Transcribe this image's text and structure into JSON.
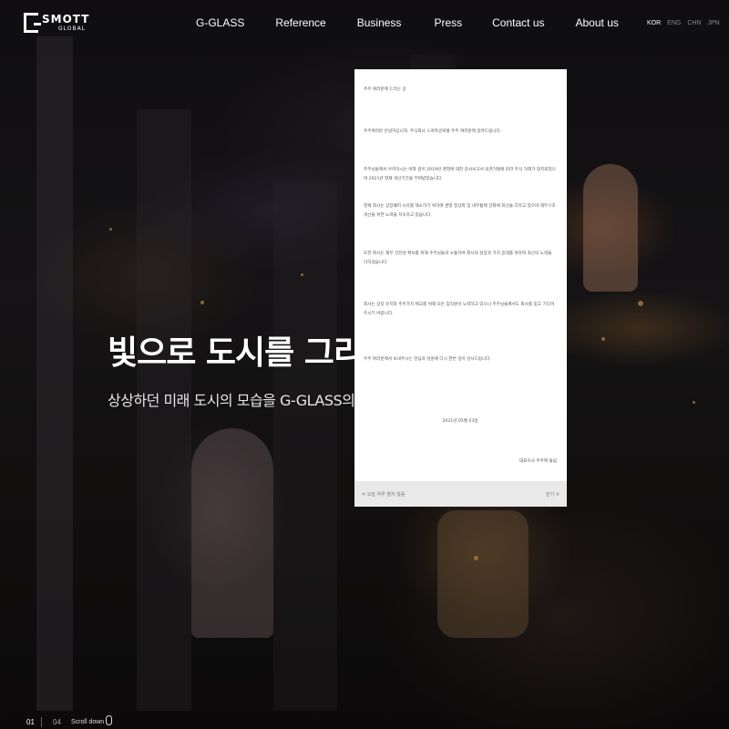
{
  "header": {
    "logo": {
      "word": "SMOTT",
      "sub": "GLOBAL"
    },
    "nav": [
      "G-GLASS",
      "Reference",
      "Business",
      "Press",
      "Contact us",
      "About us"
    ],
    "languages": [
      "KOR",
      "ENG",
      "CHN",
      "JPN"
    ],
    "active_language": "KOR"
  },
  "hero": {
    "title": "빛으로 도시를 그리다",
    "subtitle": "상상하던 미래 도시의 모습을 G-GLASS의 기술로 현실화 합니다"
  },
  "popup": {
    "greeting": "주주 여러분께 드리는 글",
    "paragraphs": [
      "주주여러분 안녕하십니까, 주식회사 스마트글로벌 주주 여러분께 알려드립니다.",
      "주주님들께서 우려하시는 바와 같이 2019년 경영에 대한 감사보고서 의견거절에 따라 주식 거래가 정지되었으며 2021년 현재 개선기간을 부여받았습니다.",
      "현재 회사는 상장폐지 사유를 해소하기 위하여 경영 정상화 및 내부통제 강화에 최선을 다하고 있으며 재무구조 개선을 위한 노력을 지속하고 있습니다.",
      "또한 회사는 재무 건전성 확보를 위해 주주님들과 소통하며 회사의 성장과 가치 증대를 위하여 최선의 노력을 다하겠습니다.",
      "회사는 상장 유지와 주주가치 제고를 위해 모든 임직원이 노력하고 있으니 주주님들께서도 회사를 믿고 기다려 주시기 바랍니다.",
      "주주 여러분께서 보내주시는 관심과 성원에 다시 한번 깊이 감사드립니다."
    ],
    "date": "2021년 05월 03일",
    "signature": "대표이사 주주께 올림",
    "footer_left": "✕ 오늘 하루 열지 않음",
    "footer_right": "닫기 ✕"
  },
  "bottom": {
    "current_page": "01",
    "total_pages": "04",
    "scroll_label": "Scroll down"
  }
}
